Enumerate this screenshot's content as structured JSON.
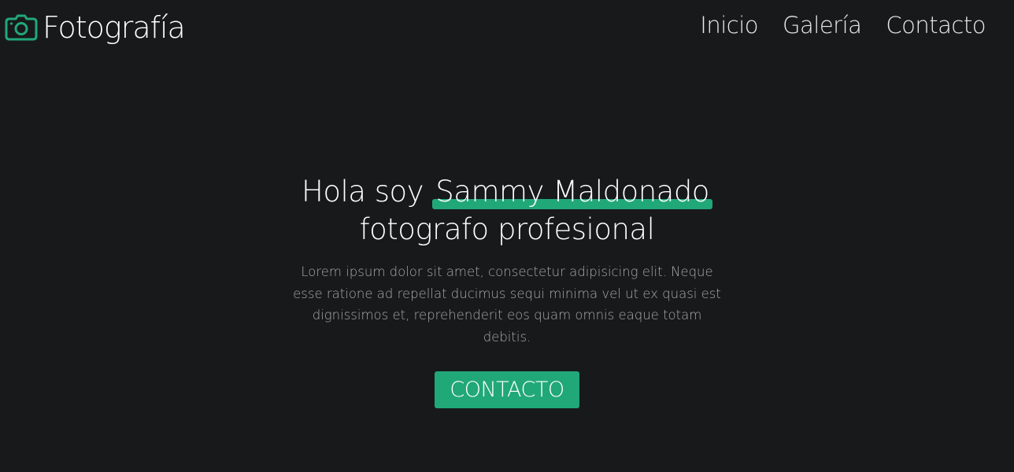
{
  "header": {
    "brand": {
      "icon": "camera-icon",
      "title": "Fotografía"
    },
    "nav": [
      {
        "label": "Inicio"
      },
      {
        "label": "Galería"
      },
      {
        "label": "Contacto"
      }
    ]
  },
  "hero": {
    "greeting": "Hola soy",
    "name": "Sammy Maldonado",
    "subtitle": "fotografo profesional",
    "description": "Lorem ipsum dolor sit amet, consectetur adipisicing elit. Neque esse ratione ad repellat ducimus sequi minima vel ut ex quasi est dignissimos et, reprehenderit eos quam omnis eaque totam debitis.",
    "cta_label": "CONTACTO"
  },
  "colors": {
    "background": "#18191b",
    "accent": "#21a878",
    "text": "#ffffff",
    "muted_text": "#a8a8a8"
  }
}
